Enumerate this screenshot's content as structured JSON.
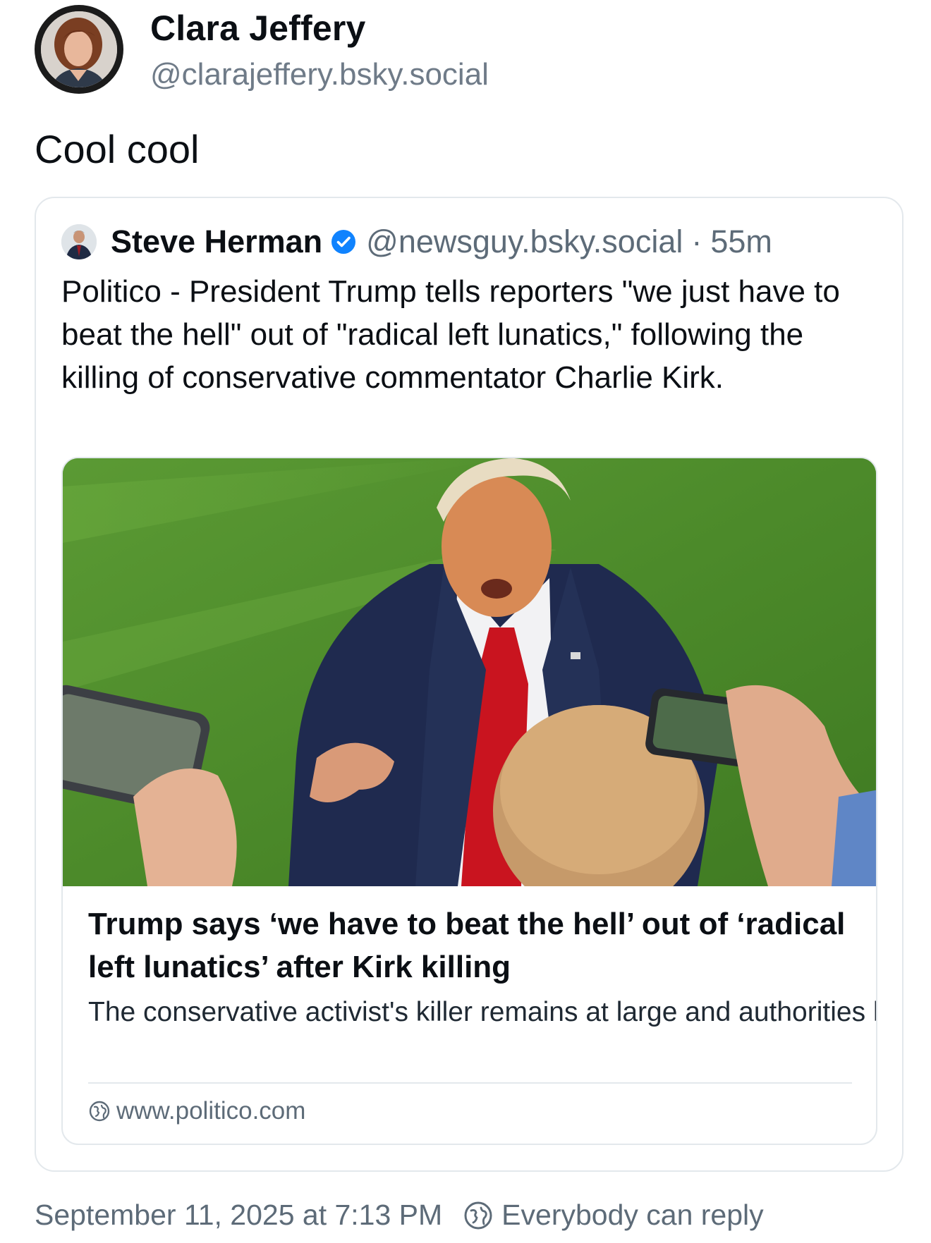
{
  "post": {
    "author_name": "Clara Jeffery",
    "author_handle": "@clarajeffery.bsky.social",
    "text": "Cool cool",
    "timestamp": "September 11, 2025 at 7:13 PM",
    "reply_setting": "Everybody can reply",
    "reply_icon": "earth-circle-icon"
  },
  "quote": {
    "author_name": "Steve Herman",
    "verified": true,
    "verified_color": "#1083fe",
    "author_handle": "@newsguy.bsky.social",
    "separator": "·",
    "time_ago": "55m",
    "text": "Politico - President Trump tells reporters \"we just have to beat the hell\" out of \"radical left lunatics,\" following the killing of conservative commentator Charlie Kirk.",
    "link": {
      "title": "Trump says ‘we have to beat the hell’ out of ‘radical left lunatics’ after Kirk killing",
      "description": "The conservative activist's killer remains at large and authorities have not said what the motive was behind hi...",
      "domain": "www.politico.com",
      "domain_icon": "globe-icon"
    }
  }
}
